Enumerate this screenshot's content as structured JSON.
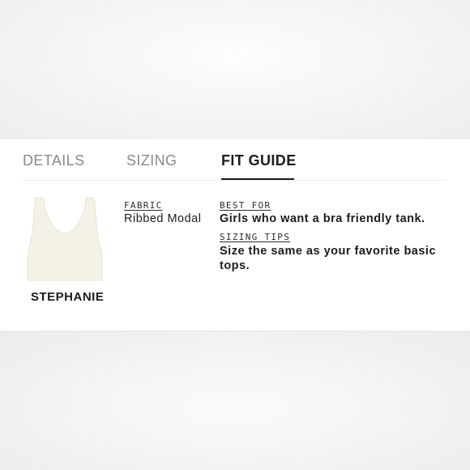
{
  "tabs": [
    {
      "label": "DETAILS"
    },
    {
      "label": "SIZING"
    },
    {
      "label": "FIT GUIDE"
    }
  ],
  "active_tab": "FIT GUIDE",
  "product": {
    "name": "STEPHANIE",
    "image_color": "#f4f1e6"
  },
  "fabric": {
    "label": "FABRIC",
    "value": "Ribbed Modal"
  },
  "best_for": {
    "label": "BEST FOR",
    "value": "Girls who want a bra friendly tank."
  },
  "sizing_tips": {
    "label": "SIZING TIPS",
    "value": "Size the same as your favorite basic tops."
  }
}
